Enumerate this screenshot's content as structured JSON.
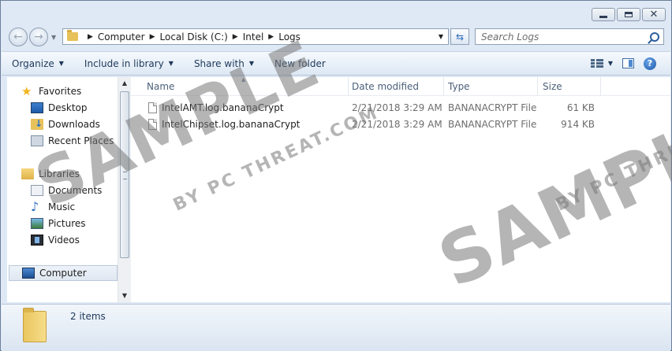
{
  "address": {
    "crumbs": [
      "Computer",
      "Local Disk (C:)",
      "Intel",
      "Logs"
    ]
  },
  "search": {
    "placeholder": "Search Logs"
  },
  "toolbar": {
    "organize": "Organize",
    "include_in_library": "Include in library",
    "share_with": "Share with",
    "new_folder": "New folder"
  },
  "nav": {
    "favorites": "Favorites",
    "desktop": "Desktop",
    "downloads": "Downloads",
    "recent_places": "Recent Places",
    "libraries": "Libraries",
    "documents": "Documents",
    "music": "Music",
    "pictures": "Pictures",
    "videos": "Videos",
    "computer": "Computer"
  },
  "columns": {
    "name": "Name",
    "date_modified": "Date modified",
    "type": "Type",
    "size": "Size"
  },
  "files": [
    {
      "name": "IntelAMT.log.bananaCrypt",
      "date": "2/21/2018 3:29 AM",
      "type": "BANANACRYPT File",
      "size": "61 KB"
    },
    {
      "name": "IntelChipset.log.bananaCrypt",
      "date": "2/21/2018 3:29 AM",
      "type": "BANANACRYPT File",
      "size": "914 KB"
    }
  ],
  "details": {
    "item_count": "2 items"
  },
  "watermark": {
    "main": "SAMPLE",
    "sub": "BY PC THREAT.COM"
  }
}
